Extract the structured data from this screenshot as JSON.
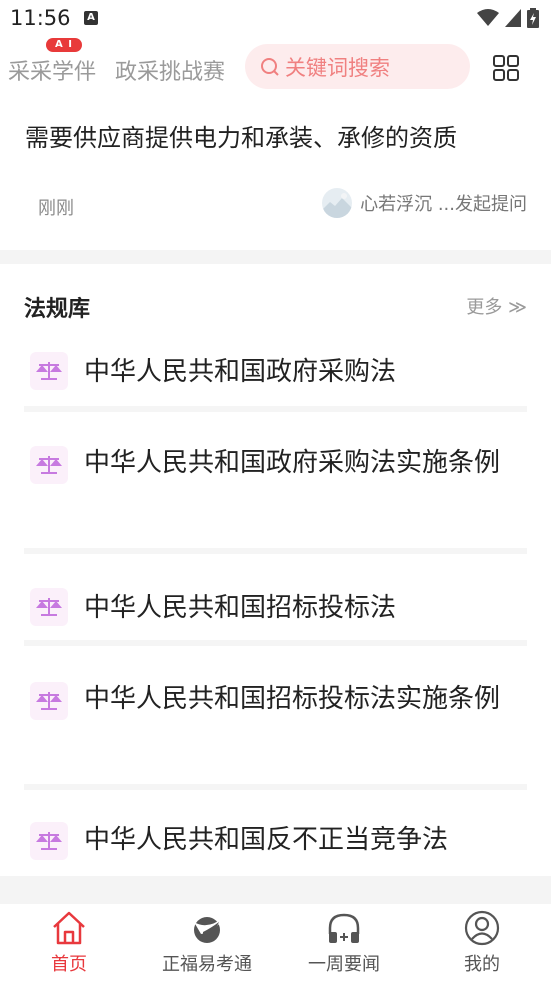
{
  "status_bar": {
    "time": "11:56",
    "notification_glyph": "A"
  },
  "top_nav": {
    "tabs": [
      {
        "label": "采采学伴",
        "badge": "A I"
      },
      {
        "label": "政采挑战赛"
      }
    ],
    "search": {
      "placeholder": "关键词搜索"
    },
    "grid_icon": "grid-icon"
  },
  "question": {
    "title": "需要供应商提供电力和承装、承修的资质",
    "time": "刚刚",
    "user": "心若浮沉 ...发起提问"
  },
  "law_library": {
    "title": "法规库",
    "more_label": "更多 ≫",
    "items": [
      {
        "label": "中华人民共和国政府采购法"
      },
      {
        "label": "中华人民共和国政府采购法实施条例"
      },
      {
        "label": "中华人民共和国招标投标法"
      },
      {
        "label": "中华人民共和国招标投标法实施条例"
      },
      {
        "label": "中华人民共和国反不正当竞争法"
      }
    ]
  },
  "tab_bar": {
    "tabs": [
      {
        "label": "首页",
        "icon": "home-icon",
        "active": true
      },
      {
        "label": "正福易考通",
        "icon": "bird-logo-icon"
      },
      {
        "label": "一周要闻",
        "icon": "headphones-icon"
      },
      {
        "label": "我的",
        "icon": "user-icon"
      }
    ]
  },
  "colors": {
    "accent": "#e8383d",
    "search_bg": "#fdeced",
    "law_icon": "#c77ae0"
  }
}
